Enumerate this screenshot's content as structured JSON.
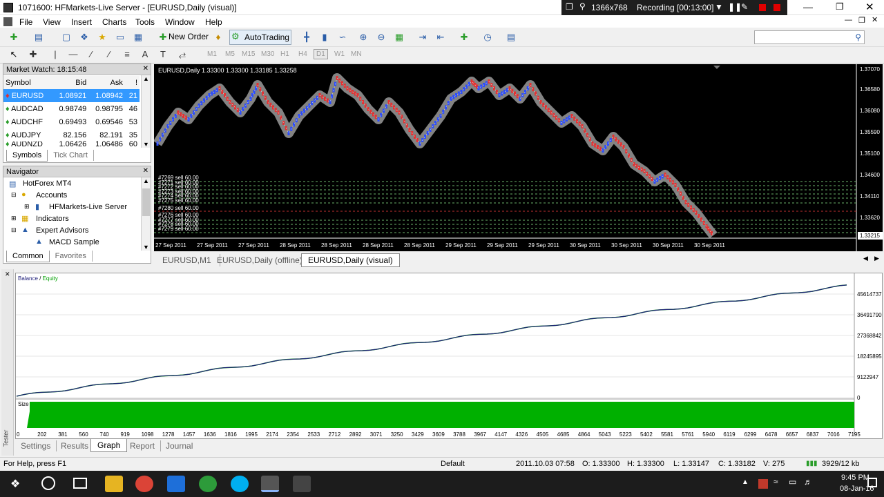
{
  "window": {
    "title": "1071600: HFMarkets-Live Server - [EURUSD,Daily (visual)]"
  },
  "recorder": {
    "resolution": "1366x768",
    "status": "Recording [00:13:00]"
  },
  "menu": [
    "File",
    "View",
    "Insert",
    "Charts",
    "Tools",
    "Window",
    "Help"
  ],
  "toolbar": {
    "new_order": "New Order",
    "autotrading": "AutoTrading",
    "timeframes": [
      "M1",
      "M5",
      "M15",
      "M30",
      "H1",
      "H4",
      "D1",
      "W1",
      "MN"
    ]
  },
  "market_watch": {
    "title": "Market Watch: 18:15:48",
    "headers": [
      "Symbol",
      "Bid",
      "Ask",
      "!"
    ],
    "rows": [
      {
        "symbol": "EURUSD",
        "bid": "1.08921",
        "ask": "1.08942",
        "spread": "21"
      },
      {
        "symbol": "AUDCAD",
        "bid": "0.98749",
        "ask": "0.98795",
        "spread": "46"
      },
      {
        "symbol": "AUDCHF",
        "bid": "0.69493",
        "ask": "0.69546",
        "spread": "53"
      },
      {
        "symbol": "AUDJPY",
        "bid": "82.156",
        "ask": "82.191",
        "spread": "35"
      },
      {
        "symbol": "AUDNZD",
        "bid": "1.06426",
        "ask": "1.06486",
        "spread": "60"
      }
    ],
    "tabs": [
      "Symbols",
      "Tick Chart"
    ]
  },
  "navigator": {
    "title": "Navigator",
    "items": [
      "HotForex MT4",
      "Accounts",
      "HFMarkets-Live Server",
      "Indicators",
      "Expert Advisors",
      "MACD Sample"
    ],
    "tabs": [
      "Common",
      "Favorites"
    ]
  },
  "chart": {
    "header": "EURUSD,Daily  1.33300 1.33300 1.33185 1.33258",
    "price_axis": [
      "1.37070",
      "1.36580",
      "1.36080",
      "1.35590",
      "1.35100",
      "1.34600",
      "1.34110",
      "1.33620",
      "1.33215"
    ],
    "time_axis": [
      "27 Sep 2011",
      "27 Sep 2011",
      "27 Sep 2011",
      "28 Sep 2011",
      "28 Sep 2011",
      "28 Sep 2011",
      "28 Sep 2011",
      "29 Sep 2011",
      "29 Sep 2011",
      "29 Sep 2011",
      "30 Sep 2011",
      "30 Sep 2011",
      "30 Sep 2011",
      "30 Sep 2011"
    ],
    "orders": [
      "#7269 sell 60.00",
      "#7271 sell 60.00",
      "#7272 sell 60.00",
      "#7273 sell 60.00",
      "#7274 sell 60.00",
      "#7275 sell 60.00",
      "#7280 sell 60.00",
      "#7276 sell 60.00",
      "#7277 sell 60.00",
      "#7278 sell 60.00",
      "#7279 sell 60.00"
    ],
    "tabs": [
      "EURUSD,M1",
      "EURUSD,Daily (offline)",
      "EURUSD,Daily (visual)"
    ]
  },
  "equity": {
    "legend_balance": "Balance",
    "legend_sep": " / ",
    "legend_equity": "Equity",
    "y_labels": [
      "45614737",
      "36491790",
      "27368842",
      "18245895",
      "9122947",
      "0"
    ],
    "size_label": "Size",
    "x_labels": [
      "0",
      "202",
      "381",
      "560",
      "740",
      "919",
      "1098",
      "1278",
      "1457",
      "1636",
      "1816",
      "1995",
      "2174",
      "2354",
      "2533",
      "2712",
      "2892",
      "3071",
      "3250",
      "3429",
      "3609",
      "3788",
      "3967",
      "4147",
      "4326",
      "4505",
      "4685",
      "4864",
      "5043",
      "5223",
      "5402",
      "5581",
      "5761",
      "5940",
      "6119",
      "6299",
      "6478",
      "6657",
      "6837",
      "7016",
      "7195"
    ],
    "colors": {
      "balance": "#1f1f7a",
      "equity": "#00a000",
      "size": "#00b000"
    }
  },
  "tester": {
    "side_label": "Tester",
    "tabs": [
      "Settings",
      "Results",
      "Graph",
      "Report",
      "Journal"
    ]
  },
  "status": {
    "help": "For Help, press F1",
    "profile": "Default",
    "time": "2011.10.03 07:58",
    "open": "O: 1.33300",
    "high": "H: 1.33300",
    "low": "L: 1.33147",
    "close": "C: 1.33182",
    "volume": "V: 275",
    "traffic": "3929/12 kb"
  },
  "taskbar": {
    "time": "9:45 PM",
    "date": "08-Jan-16"
  }
}
